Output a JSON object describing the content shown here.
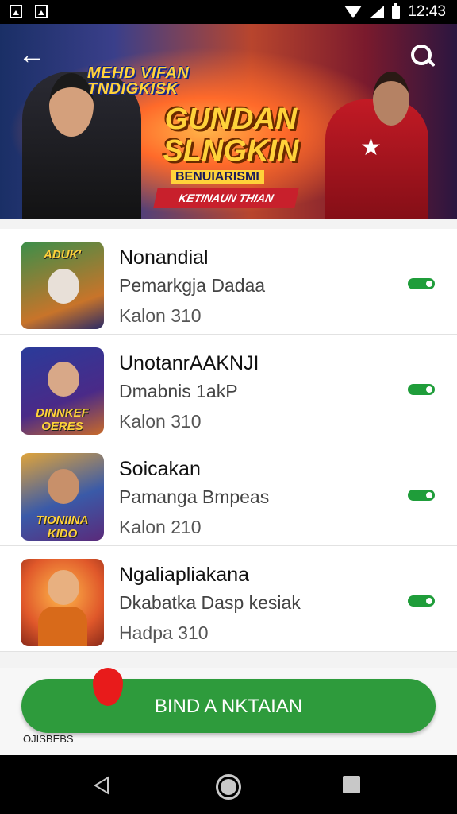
{
  "status_bar": {
    "time": "12:43"
  },
  "banner": {
    "title_small": "MEHD VIFAN\nTNDIGKISK",
    "title_big": "GUNDAN SLNGKIN",
    "subtitle": "BENUIARISMI",
    "ribbon": "KETINAUN THIAN"
  },
  "list": {
    "items": [
      {
        "title": "Nonandial",
        "subtitle": "Pemarkgja Dadaa",
        "meta": "Kalon  310",
        "thumb_text": "ADUK'",
        "thumb_bg": "#3b8f4a"
      },
      {
        "title": "UnotanrAAKNJI",
        "subtitle": "Dmabnis 1akP",
        "meta": "Kalon  310",
        "thumb_text": "DINNKEF OERES",
        "thumb_bg": "#2a3b9a"
      },
      {
        "title": "Soicakan",
        "subtitle": "Pamanga Bmpeas",
        "meta": "Kalon  210",
        "thumb_text": "TIONIINA KIDO",
        "thumb_bg": "#e0a43a"
      },
      {
        "title": "Ngaliapliakana",
        "subtitle": "Dkabatka Dasp kesiak",
        "meta": "Hadpa  310",
        "thumb_text": "",
        "thumb_bg": "#e0582a"
      }
    ]
  },
  "cta": {
    "label": "BIND A NKTAIAN"
  },
  "footnote": "OJISBEBS",
  "colors": {
    "accent_green": "#2e9b3c",
    "toggle_green": "#1f9d3a"
  }
}
